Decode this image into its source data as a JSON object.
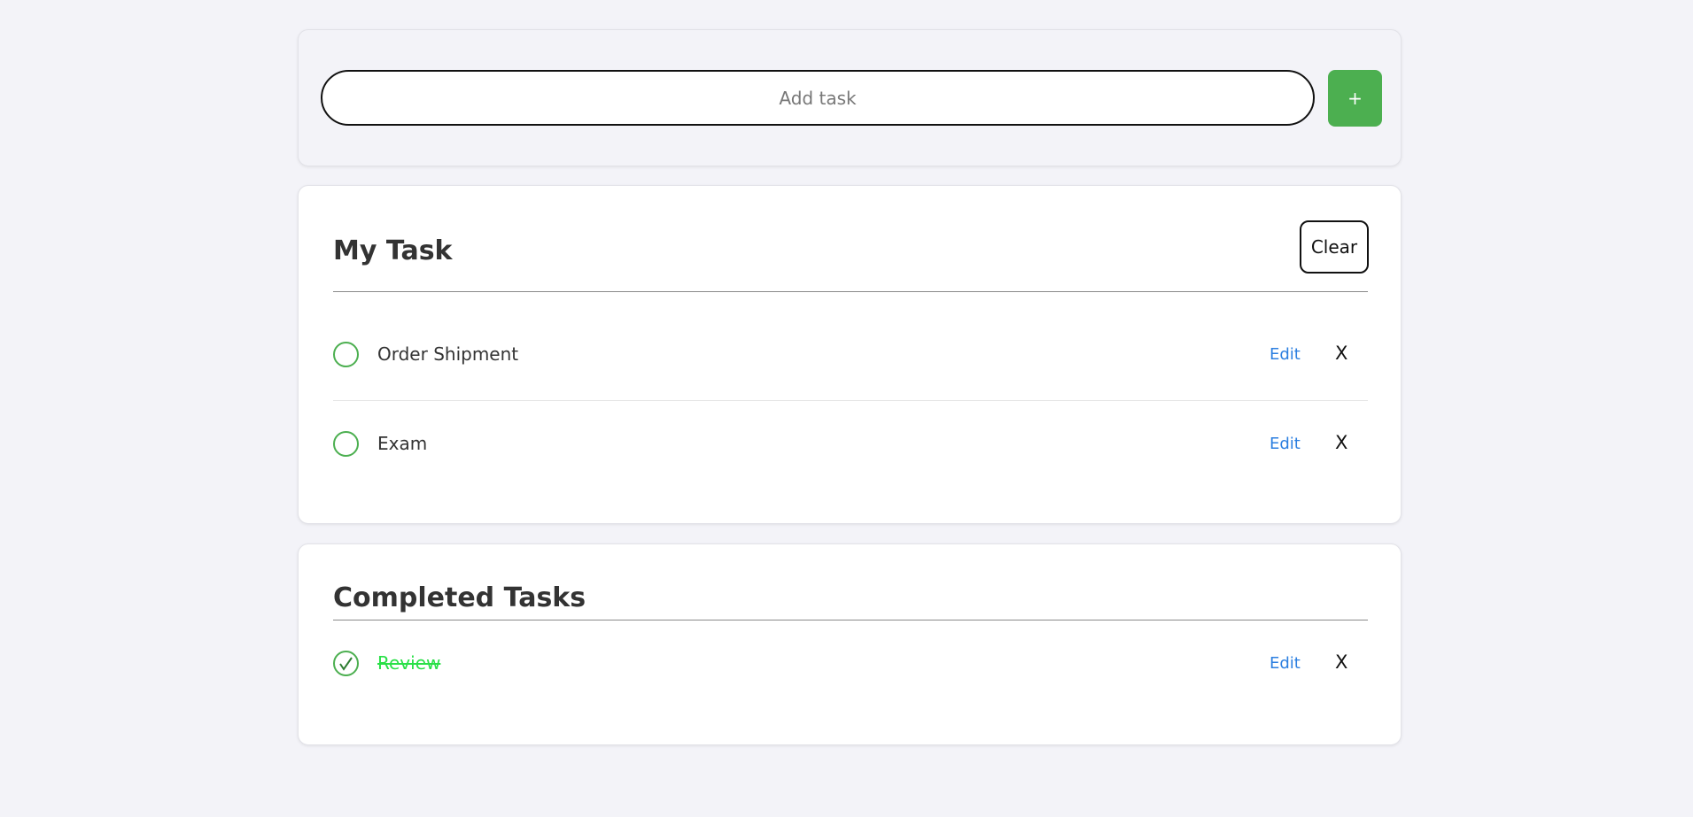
{
  "add_task": {
    "placeholder": "Add task",
    "button_label": "+"
  },
  "my_tasks": {
    "title": "My Task",
    "clear_label": "Clear",
    "items": [
      {
        "label": "Order Shipment",
        "edit_label": "Edit",
        "delete_label": "X",
        "completed": false
      },
      {
        "label": "Exam",
        "edit_label": "Edit",
        "delete_label": "X",
        "completed": false
      }
    ]
  },
  "completed_tasks": {
    "title": "Completed Tasks",
    "items": [
      {
        "label": "Review",
        "edit_label": "Edit",
        "delete_label": "X",
        "completed": true
      }
    ]
  },
  "colors": {
    "accent_green": "#4caf50",
    "done_text": "#29e047",
    "edit_link": "#2c7fe0",
    "background": "#f3f3f8"
  },
  "icons": {
    "check_empty": "circle-icon",
    "check_done": "check-circle-icon"
  }
}
